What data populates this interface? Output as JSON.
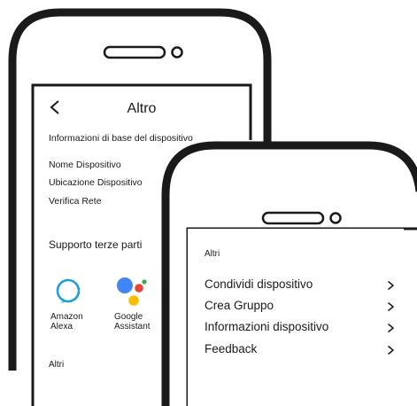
{
  "back_screen": {
    "title": "Altro",
    "section_title": "Informazioni di base del dispositivo",
    "items": [
      {
        "label": "Nome Dispositivo"
      },
      {
        "label": "Ubicazione Dispositivo"
      },
      {
        "label": "Verifica Rete"
      }
    ],
    "third_party_title": "Supporto terze parti",
    "integrations": [
      {
        "name_line1": "Amazon",
        "name_line2": "Alexa",
        "icon": "alexa-icon",
        "color": "#1ca0d9"
      },
      {
        "name_line1": "Google",
        "name_line2": "Assistant",
        "icon": "google-assistant-icon",
        "colors": [
          "#4285f4",
          "#ea4335",
          "#fbbc05",
          "#34a853"
        ]
      }
    ],
    "others_label": "Altri"
  },
  "front_screen": {
    "others_label": "Altri",
    "items": [
      {
        "label": "Condividi dispositivo"
      },
      {
        "label": "Crea Gruppo"
      },
      {
        "label": "Informazioni dispositivo"
      },
      {
        "label": "Feedback"
      }
    ]
  },
  "colors": {
    "outline": "#1a1a1a",
    "text": "#1a1a1a"
  }
}
